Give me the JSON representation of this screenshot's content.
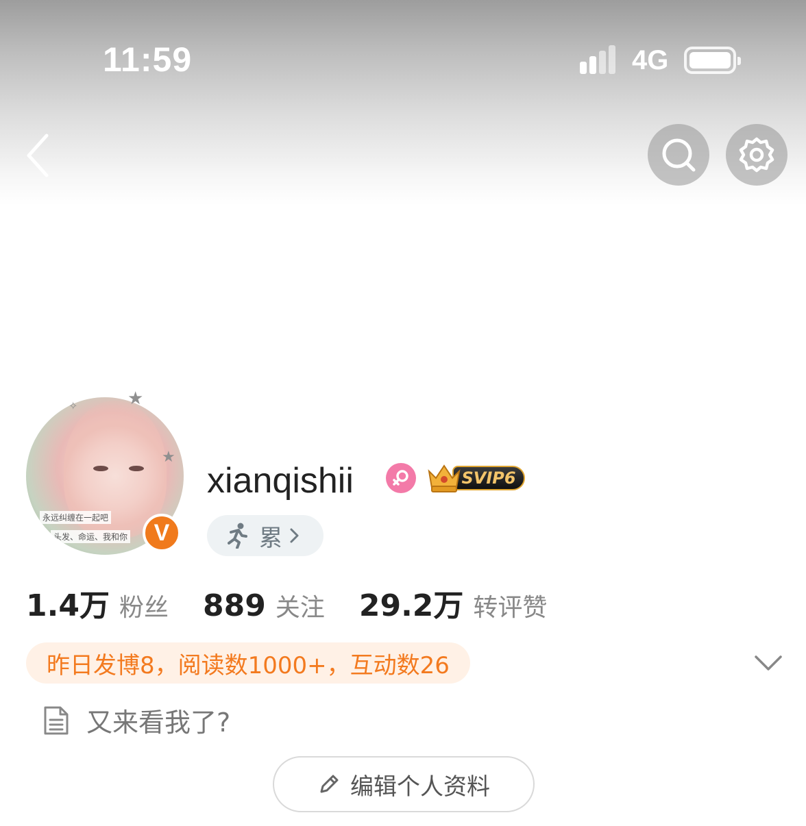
{
  "status_bar": {
    "time": "11:59",
    "network": "4G"
  },
  "nav": {
    "back_icon": "chevron-left-icon",
    "search_icon": "search-icon",
    "settings_icon": "gear-icon"
  },
  "profile": {
    "avatar_caption_1": "永远纠缠在一起吧",
    "avatar_caption_2": "头发、命运、我和你",
    "verified_mark": "V",
    "username": "xianqishii",
    "gender": "female",
    "vip_badge": "SVIP6",
    "mood_status": "累"
  },
  "stats": [
    {
      "value": "1.4万",
      "label": "粉丝"
    },
    {
      "value": "889",
      "label": "关注"
    },
    {
      "value": "29.2万",
      "label": "转评赞"
    }
  ],
  "activity": {
    "text": "昨日发博8，阅读数1000+，互动数26"
  },
  "bio": {
    "text": "又来看我了?"
  },
  "actions": {
    "edit_profile_label": "编辑个人资料"
  },
  "colors": {
    "accent_orange": "#f37a1f",
    "verified_orange": "#f07a1c",
    "female_pink": "#f37aa8",
    "vip_gold": "#e0a530"
  }
}
